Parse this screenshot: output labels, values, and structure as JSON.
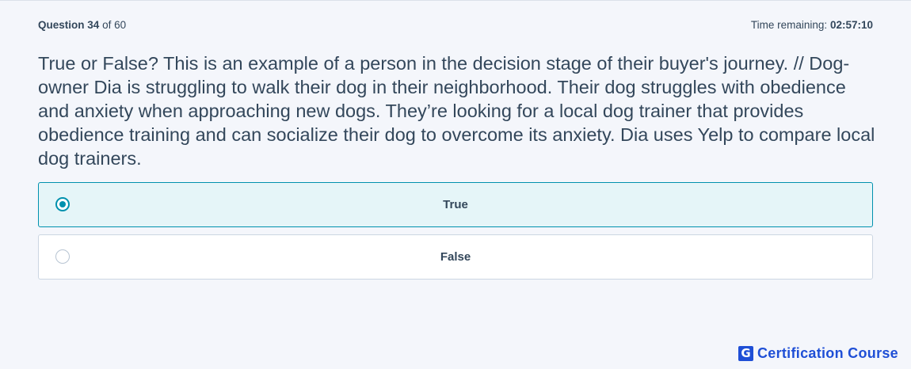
{
  "header": {
    "question_word": "Question",
    "question_number": "34",
    "question_of": "of 60",
    "timer_label": "Time remaining:",
    "timer_value": "02:57:10"
  },
  "question": {
    "text": "True or False? This is an example of a person in the decision stage of their buyer's journey. // Dog-owner Dia is struggling to walk their dog in their neighborhood. Their dog struggles with obedience and anxiety when approaching new dogs. They’re looking for a local dog trainer that provides obedience training and can socialize their dog to overcome its anxiety. Dia uses Yelp to compare local dog trainers."
  },
  "options": [
    {
      "label": "True",
      "selected": true
    },
    {
      "label": "False",
      "selected": false
    }
  ],
  "brand": {
    "logo_letter": "G",
    "name": "Certification Course",
    "color": "#1f4fd6"
  },
  "colors": {
    "accent": "#0091ae",
    "text": "#33475b",
    "selected_bg": "#e5f5f8",
    "page_bg": "#f4f6fb"
  }
}
